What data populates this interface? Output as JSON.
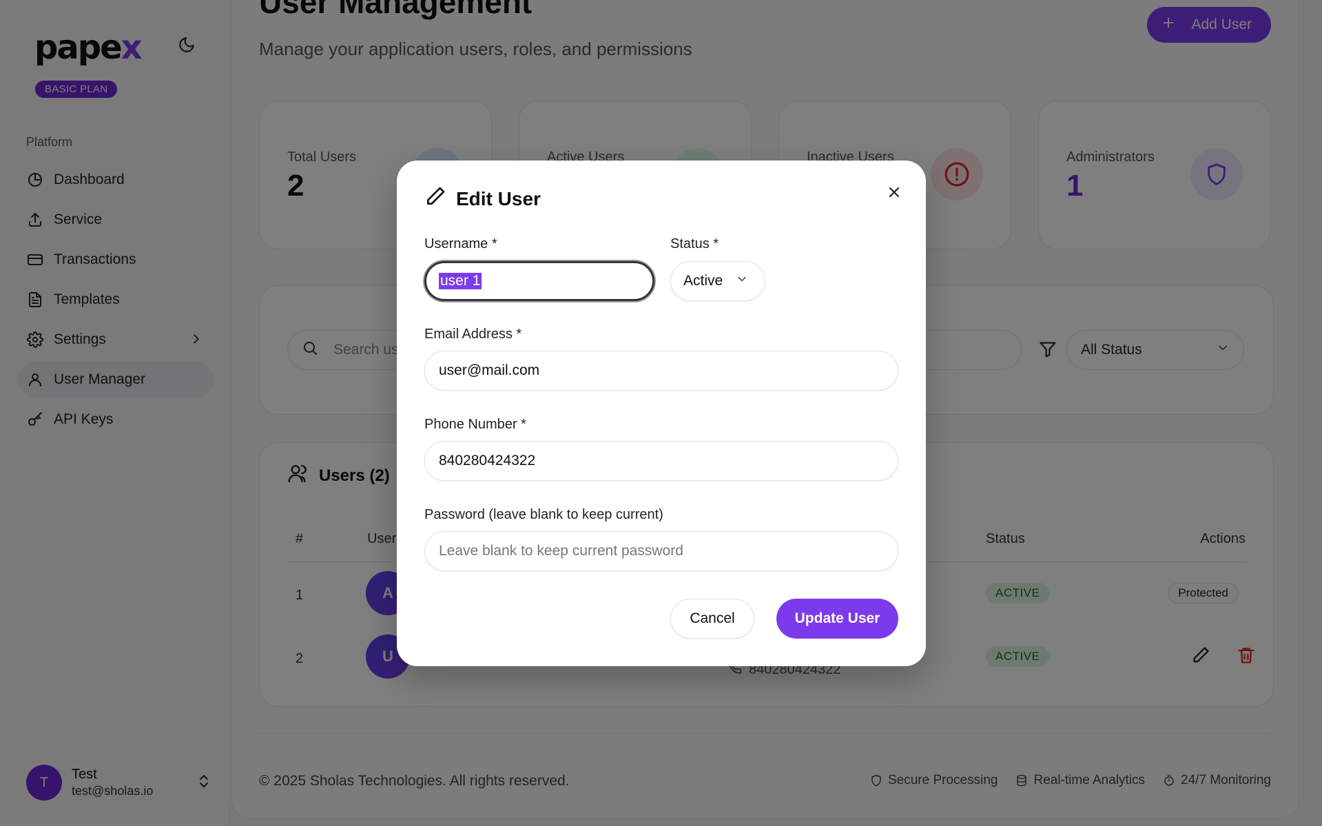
{
  "sidebar": {
    "logo": {
      "text_main": "pape",
      "text_accent": "x"
    },
    "plan_badge": "BASIC PLAN",
    "group_label": "Platform",
    "items": [
      {
        "label": "Dashboard",
        "icon": "pie-chart-icon"
      },
      {
        "label": "Service",
        "icon": "upload-icon"
      },
      {
        "label": "Transactions",
        "icon": "credit-card-icon"
      },
      {
        "label": "Templates",
        "icon": "file-text-icon"
      },
      {
        "label": "Settings",
        "icon": "gear-icon"
      },
      {
        "label": "User Manager",
        "icon": "user-icon",
        "active": true
      },
      {
        "label": "API Keys",
        "icon": "key-icon"
      }
    ],
    "user": {
      "initial": "T",
      "name": "Test",
      "email": "test@sholas.io"
    }
  },
  "header": {
    "title": "User Management",
    "subtitle": "Manage your application users, roles, and permissions",
    "add_user_label": "Add User"
  },
  "stats": [
    {
      "label": "Total Users",
      "value": "2",
      "color": "#3b82f6"
    },
    {
      "label": "Active Users",
      "value": "",
      "color": "#22c55e"
    },
    {
      "label": "Inactive Users",
      "value": "",
      "color": "#dc2626"
    },
    {
      "label": "Administrators",
      "value": "1",
      "color": "#7c3aed"
    }
  ],
  "filters": {
    "search_placeholder": "Search us",
    "status_value": "All Status"
  },
  "users_table": {
    "title": "Users (2)",
    "columns": {
      "num": "#",
      "user": "User",
      "status": "Status",
      "actions": "Actions"
    },
    "rows": [
      {
        "num": "1",
        "initial": "A",
        "status": "ACTIVE",
        "action_label": "Protected"
      },
      {
        "num": "2",
        "initial": "U",
        "status": "ACTIVE",
        "phone": "840280424322"
      }
    ]
  },
  "footer": {
    "copyright": "© 2025 Sholas Technologies. All rights reserved.",
    "items": [
      "Secure Processing",
      "Real-time Analytics",
      "24/7 Monitoring"
    ]
  },
  "modal": {
    "title": "Edit User",
    "username_label": "Username *",
    "username_value": "user 1",
    "status_label": "Status *",
    "status_value": "Active",
    "email_label": "Email Address *",
    "email_value": "user@mail.com",
    "phone_label": "Phone Number *",
    "phone_value": "840280424322",
    "password_label": "Password (leave blank to keep current)",
    "password_placeholder": "Leave blank to keep current password",
    "cancel_label": "Cancel",
    "update_label": "Update User"
  },
  "colors": {
    "accent": "#7c3aed",
    "active_badge_bg": "#dcf5e3",
    "active_badge_text": "#166534",
    "danger": "#dc2626"
  }
}
